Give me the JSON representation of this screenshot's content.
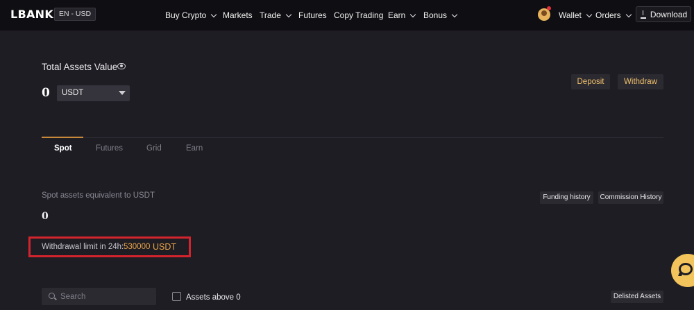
{
  "nav": {
    "logo": "LBANK",
    "lang": "EN - USD",
    "menu": [
      "Buy Crypto",
      "Markets",
      "Trade",
      "Futures",
      "Copy Trading",
      "Earn",
      "Bonus"
    ],
    "wallet": "Wallet",
    "orders": "Orders",
    "download": "Download"
  },
  "assets": {
    "title": "Total Assets Value",
    "value": "0",
    "currency": "USDT",
    "deposit": "Deposit",
    "withdraw": "Withdraw"
  },
  "tabs": [
    "Spot",
    "Futures",
    "Grid",
    "Earn"
  ],
  "spot": {
    "label": "Spot assets equivalent to USDT",
    "value": "0",
    "funding_history": "Funding history",
    "commission_history": "Commission History",
    "withdrawal_limit_label": "Withdrawal limit in 24h:",
    "withdrawal_limit_amount": "530000",
    "withdrawal_limit_unit": "USDT"
  },
  "filters": {
    "search_placeholder": "Search",
    "assets_above_zero": "Assets above 0",
    "delisted_assets": "Delisted Assets"
  },
  "colors": {
    "accent": "#e8a44a",
    "highlight_border": "#d3242d",
    "chat_button": "#f3c45c"
  },
  "icons": [
    "eye-icon",
    "caret-down-icon",
    "download-icon",
    "search-icon",
    "chat-icon"
  ]
}
